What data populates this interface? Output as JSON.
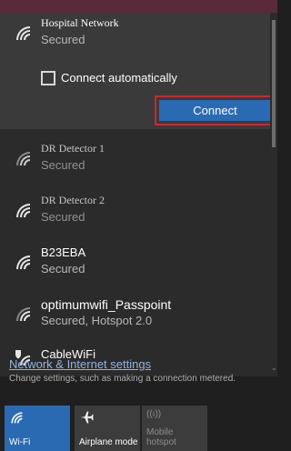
{
  "networks": [
    {
      "name": "Hospital Network",
      "status": "Secured",
      "selected": true
    },
    {
      "name": "DR Detector 1",
      "status": "Secured"
    },
    {
      "name": "DR Detector 2",
      "status": "Secured"
    },
    {
      "name": "B23EBA",
      "status": "Secured"
    },
    {
      "name": "optimumwifi_Passpoint",
      "status": "Secured, Hotspot 2.0"
    },
    {
      "name": "CableWiFi",
      "status": ""
    }
  ],
  "connect_automatically_label": "Connect automatically",
  "connect_automatically_checked": false,
  "connect_button_label": "Connect",
  "settings": {
    "link_text": "Network & Internet settings",
    "description": "Change settings, such as making a connection metered."
  },
  "quick_actions": [
    {
      "label": "Wi-Fi",
      "icon": "wifi-icon",
      "active": true
    },
    {
      "label": "Airplane mode",
      "icon": "airplane-icon",
      "active": false
    },
    {
      "label": "Mobile hotspot",
      "icon": "mobile-hotspot-icon",
      "active": false,
      "disabled": true
    }
  ],
  "colors": {
    "accent": "#2a6ab3",
    "highlight_outline": "#d0262c",
    "link": "#8fb4e3"
  }
}
